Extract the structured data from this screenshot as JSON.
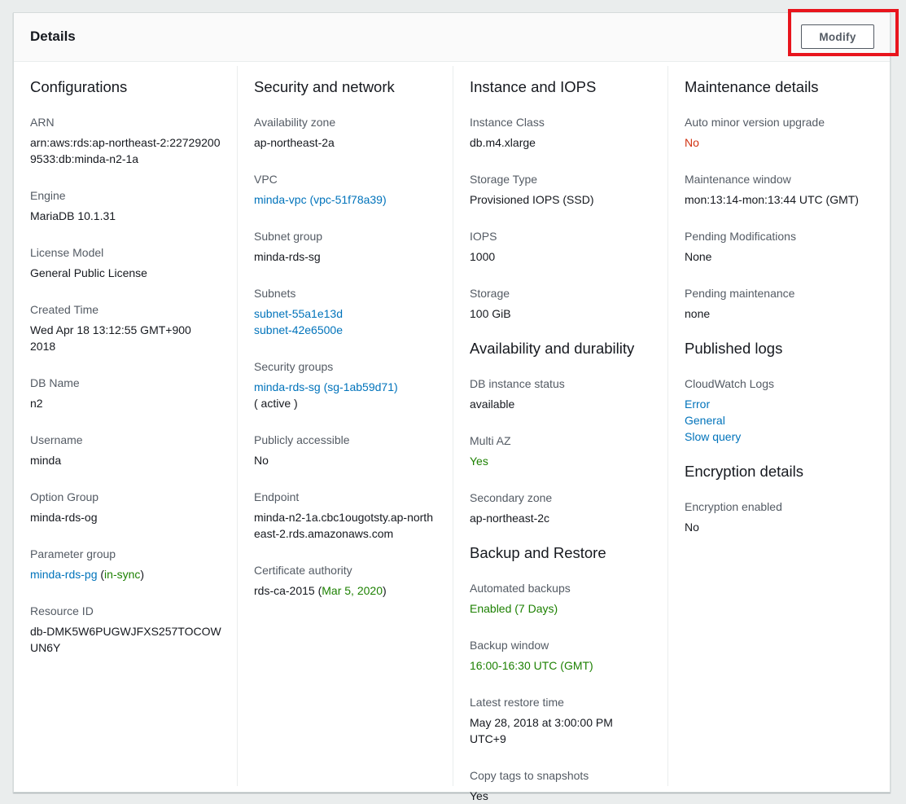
{
  "header": {
    "title": "Details",
    "modify_label": "Modify"
  },
  "configurations": {
    "title": "Configurations",
    "arn_label": "ARN",
    "arn_value": "arn:aws:rds:ap-northeast-2:227292009533:db:minda-n2-1a",
    "engine_label": "Engine",
    "engine_value": "MariaDB 10.1.31",
    "license_label": "License Model",
    "license_value": "General Public License",
    "created_label": "Created Time",
    "created_value": "Wed Apr 18 13:12:55 GMT+900 2018",
    "dbname_label": "DB Name",
    "dbname_value": "n2",
    "username_label": "Username",
    "username_value": "minda",
    "option_group_label": "Option Group",
    "option_group_value": "minda-rds-og",
    "param_group_label": "Parameter group",
    "param_group_link": "minda-rds-pg",
    "param_group_status_open": " (",
    "param_group_status": "in-sync",
    "param_group_status_close": ")",
    "resource_id_label": "Resource ID",
    "resource_id_value": "db-DMK5W6PUGWJFXS257TOCOWUN6Y"
  },
  "security": {
    "title": "Security and network",
    "az_label": "Availability zone",
    "az_value": "ap-northeast-2a",
    "vpc_label": "VPC",
    "vpc_value": "minda-vpc (vpc-51f78a39)",
    "subnet_group_label": "Subnet group",
    "subnet_group_value": "minda-rds-sg",
    "subnets_label": "Subnets",
    "subnets": [
      "subnet-55a1e13d",
      "subnet-42e6500e"
    ],
    "security_groups_label": "Security groups",
    "security_group_link": "minda-rds-sg (sg-1ab59d71)",
    "security_group_status": "( active )",
    "public_label": "Publicly accessible",
    "public_value": "No",
    "endpoint_label": "Endpoint",
    "endpoint_value": "minda-n2-1a.cbc1ougotsty.ap-northeast-2.rds.amazonaws.com",
    "cert_label": "Certificate authority",
    "cert_value": "rds-ca-2015 (",
    "cert_date": "Mar 5, 2020",
    "cert_close": ")"
  },
  "instance": {
    "title": "Instance and IOPS",
    "class_label": "Instance Class",
    "class_value": "db.m4.xlarge",
    "storage_type_label": "Storage Type",
    "storage_type_value": "Provisioned IOPS (SSD)",
    "iops_label": "IOPS",
    "iops_value": "1000",
    "storage_label": "Storage",
    "storage_value": "100 GiB"
  },
  "availability": {
    "title": "Availability and durability",
    "status_label": "DB instance status",
    "status_value": "available",
    "multi_az_label": "Multi AZ",
    "multi_az_value": "Yes",
    "secondary_label": "Secondary zone",
    "secondary_value": "ap-northeast-2c"
  },
  "backup": {
    "title": "Backup and Restore",
    "auto_label": "Automated backups",
    "auto_value": "Enabled (7 Days)",
    "window_label": "Backup window",
    "window_value": "16:00-16:30 UTC (GMT)",
    "restore_label": "Latest restore time",
    "restore_value": "May 28, 2018 at 3:00:00 PM UTC+9",
    "copy_tags_label": "Copy tags to snapshots",
    "copy_tags_value": "Yes"
  },
  "maintenance": {
    "title": "Maintenance details",
    "auto_minor_label": "Auto minor version upgrade",
    "auto_minor_value": "No",
    "window_label": "Maintenance window",
    "window_value": "mon:13:14-mon:13:44 UTC (GMT)",
    "pending_mod_label": "Pending Modifications",
    "pending_mod_value": "None",
    "pending_maint_label": "Pending maintenance",
    "pending_maint_value": "none"
  },
  "logs": {
    "title": "Published logs",
    "cloudwatch_label": "CloudWatch Logs",
    "items": [
      "Error",
      "General",
      "Slow query"
    ]
  },
  "encryption": {
    "title": "Encryption details",
    "enabled_label": "Encryption enabled",
    "enabled_value": "No"
  },
  "colors": {
    "link": "#0073bb",
    "success": "#1d8102",
    "error": "#d13212",
    "highlight": "#e8141c"
  }
}
